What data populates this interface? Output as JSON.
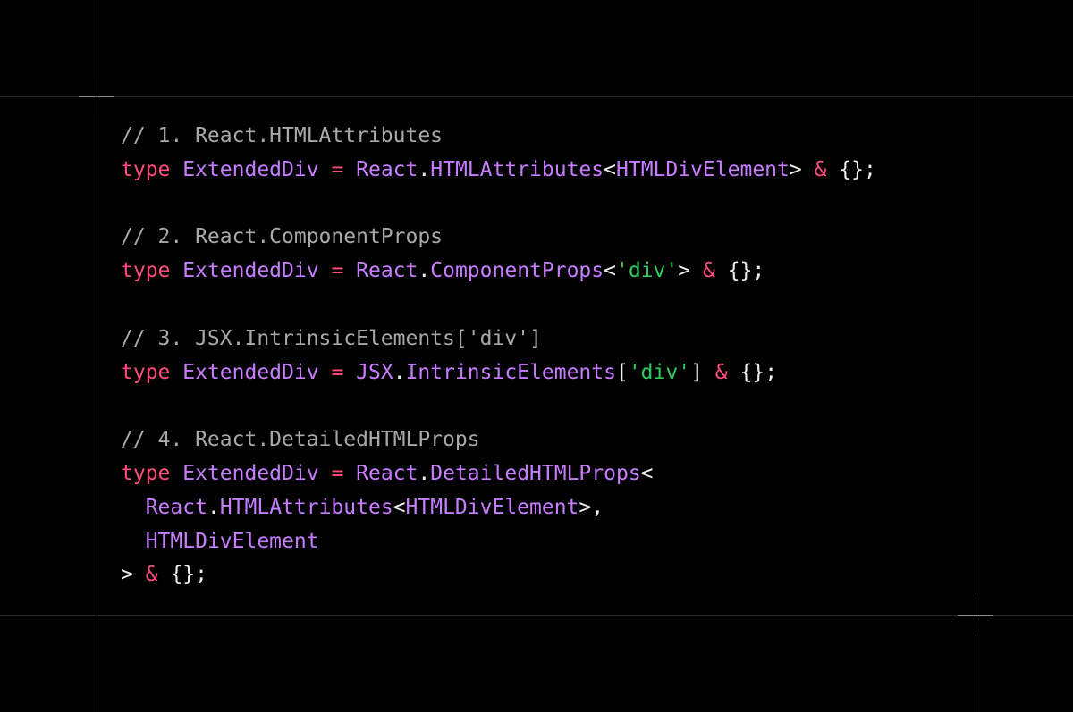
{
  "colors": {
    "background": "#000000",
    "guide_line": "#2a2a2a",
    "crosshair": "#8a8a8a",
    "comment": "#a8a8a8",
    "keyword": "#ff4d7e",
    "type": "#c77dff",
    "punctuation": "#ededed",
    "string": "#2ecc5f"
  },
  "code": {
    "section1": {
      "comment": "// 1. React.HTMLAttributes",
      "kw_type": "type",
      "alias": "ExtendedDiv",
      "eq": "=",
      "ns": "React",
      "dot": ".",
      "member": "HTMLAttributes",
      "lt": "<",
      "generic_arg": "HTMLDivElement",
      "gt": ">",
      "amp": "&",
      "tail": "{};"
    },
    "section2": {
      "comment": "// 2. React.ComponentProps",
      "kw_type": "type",
      "alias": "ExtendedDiv",
      "eq": "=",
      "ns": "React",
      "dot": ".",
      "member": "ComponentProps",
      "lt": "<",
      "string_arg": "'div'",
      "gt": ">",
      "amp": "&",
      "tail": "{};"
    },
    "section3": {
      "comment": "// 3. JSX.IntrinsicElements['div']",
      "kw_type": "type",
      "alias": "ExtendedDiv",
      "eq": "=",
      "ns": "JSX",
      "dot": ".",
      "member": "IntrinsicElements",
      "lbracket": "[",
      "string_arg": "'div'",
      "rbracket": "]",
      "amp": "&",
      "tail": "{};"
    },
    "section4": {
      "comment": "// 4. React.DetailedHTMLProps",
      "kw_type": "type",
      "alias": "ExtendedDiv",
      "eq": "=",
      "ns": "React",
      "dot": ".",
      "member": "DetailedHTMLProps",
      "lt": "<",
      "arg1_ns": "React",
      "arg1_dot": ".",
      "arg1_member": "HTMLAttributes",
      "arg1_lt": "<",
      "arg1_generic": "HTMLDivElement",
      "arg1_gt_comma": ">,",
      "arg2": "HTMLDivElement",
      "close_gt": ">",
      "amp": "&",
      "tail": "{};"
    }
  }
}
